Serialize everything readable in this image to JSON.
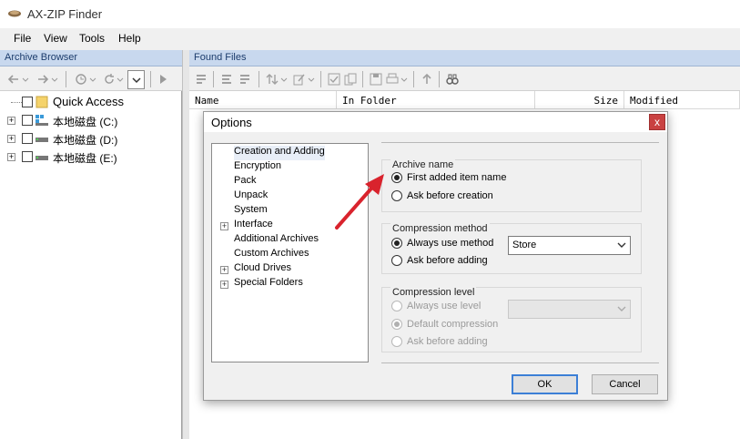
{
  "window": {
    "title": "AX-ZIP Finder"
  },
  "menu": [
    "File",
    "View",
    "Tools",
    "Help"
  ],
  "panes": {
    "archive_browser": "Archive Browser",
    "found_files": "Found Files"
  },
  "tree": [
    {
      "label": "Quick Access",
      "icon": "folder-icon"
    },
    {
      "label": "本地磁盘 (C:)",
      "icon": "drive-icon"
    },
    {
      "label": "本地磁盘 (D:)",
      "icon": "drive-icon"
    },
    {
      "label": "本地磁盘 (E:)",
      "icon": "drive-icon"
    }
  ],
  "columns": [
    "Name",
    "In Folder",
    "Size",
    "Modified"
  ],
  "dialog": {
    "title": "Options",
    "close": "x",
    "categories": [
      {
        "label": "Creation and Adding",
        "expandable": false
      },
      {
        "label": "Encryption",
        "expandable": false
      },
      {
        "label": "Pack",
        "expandable": false
      },
      {
        "label": "Unpack",
        "expandable": false
      },
      {
        "label": "System",
        "expandable": false
      },
      {
        "label": "Interface",
        "expandable": true
      },
      {
        "label": "Additional Archives",
        "expandable": false
      },
      {
        "label": "Custom Archives",
        "expandable": false
      },
      {
        "label": "Cloud Drives",
        "expandable": true
      },
      {
        "label": "Special Folders",
        "expandable": true
      }
    ],
    "archive_name": {
      "title": "Archive name",
      "options": [
        "First added item name",
        "Ask before creation"
      ],
      "selected": 0
    },
    "compression_method": {
      "title": "Compression method",
      "options": [
        "Always use method",
        "Ask before adding"
      ],
      "selected": 0,
      "method_value": "Store"
    },
    "compression_level": {
      "title": "Compression level",
      "options": [
        "Always use level",
        "Default compression",
        "Ask before adding"
      ],
      "selected": 1,
      "level_value": ""
    },
    "ok_label": "OK",
    "cancel_label": "Cancel"
  },
  "colors": {
    "pane_header_bg": "#c8d8ee",
    "close_red": "#c94141",
    "arrow_red": "#d9232d",
    "default_button_border": "#3c7fd6"
  }
}
